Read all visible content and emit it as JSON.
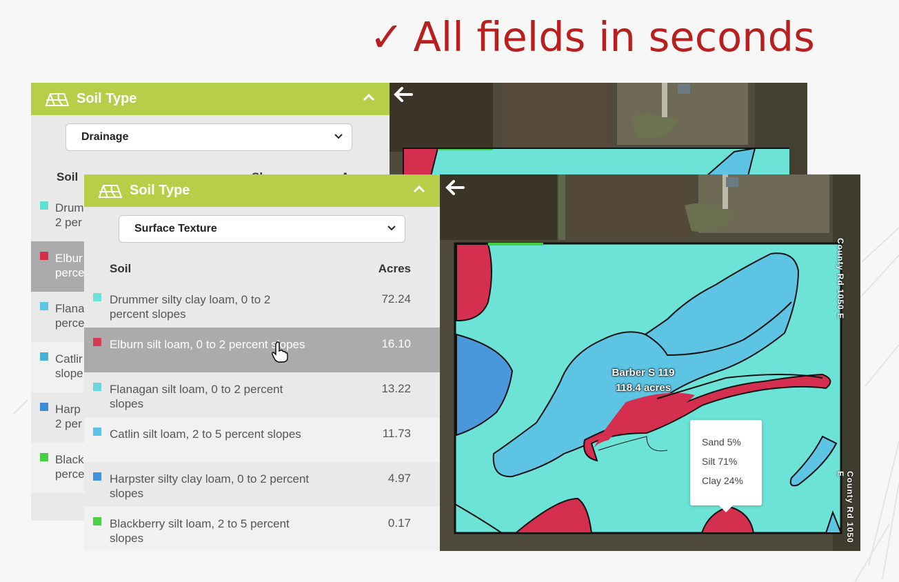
{
  "headline": {
    "check": "✓",
    "text": "All fields in seconds"
  },
  "back_panel": {
    "title": "Soil Type",
    "dropdown_value": "Drainage",
    "col_soil": "Soil",
    "col_slope_partial": "Slo",
    "col_acres_partial": "Acr",
    "rows": [
      {
        "line1": "Drum",
        "line2": "2 per",
        "color": "#5fe0d2"
      },
      {
        "line1": "Elbur",
        "line2": "perce",
        "color": "#d42e4a",
        "selected": true
      },
      {
        "line1": "Flana",
        "line2": "perce",
        "color": "#5bc7e6"
      },
      {
        "line1": "Catlir",
        "line2": "slope",
        "color": "#4ab1d8"
      },
      {
        "line1": "Harp",
        "line2": "2 per",
        "color": "#3a8ed8"
      },
      {
        "line1": "Black",
        "line2": "perce",
        "color": "#44d043"
      }
    ]
  },
  "front_panel": {
    "title": "Soil Type",
    "dropdown_value": "Surface Texture",
    "col_soil": "Soil",
    "col_acres": "Acres",
    "rows": [
      {
        "name": "Drummer silty clay loam, 0 to 2 percent slopes",
        "acres": "72.24",
        "color": "#6be3d7"
      },
      {
        "name": "Elburn silt loam, 0 to 2 percent slopes",
        "acres": "16.10",
        "color": "#d63a55"
      },
      {
        "name": "Flanagan silt loam, 0 to 2 percent slopes",
        "acres": "13.22",
        "color": "#6ad7e0"
      },
      {
        "name": "Catlin silt loam, 2 to 5 percent slopes",
        "acres": "11.73",
        "color": "#5ac3e6"
      },
      {
        "name": "Harpster silty clay loam, 0 to 2 percent slopes",
        "acres": "4.97",
        "color": "#3f93dc"
      },
      {
        "name": "Blackberry silt loam, 2 to 5 percent slopes",
        "acres": "0.17",
        "color": "#4cd046"
      }
    ]
  },
  "map": {
    "field_name": "Barber S 119",
    "field_acres": "118.4 acres",
    "tooltip": {
      "sand": "Sand 5%",
      "silt": "Silt   71%",
      "clay": "Clay  24%"
    },
    "road_top": "County Rd 1050 E",
    "road_bottom": "County Rd 1050 E"
  },
  "colors": {
    "accent_green": "#b7cf48",
    "headline_red": "#b8201f",
    "drummer": "#6de2d6",
    "elburn": "#d52f4f",
    "catlin": "#5ec4e4",
    "harpster": "#4a97dc"
  }
}
